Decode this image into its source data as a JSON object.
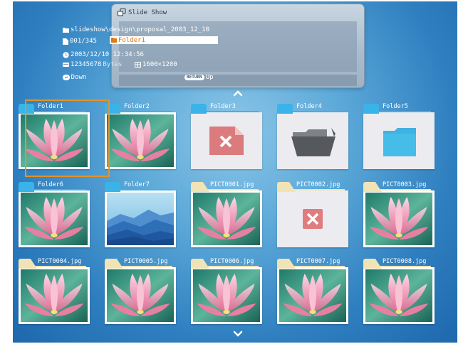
{
  "panel": {
    "title": "Slide Show",
    "path": "slideshow\\design\\proposal_2003_12_10",
    "count": "001/345",
    "folder_name": "Folder1",
    "date": "2003/12/10 12:34:56",
    "bytes_value": "12345678",
    "bytes_unit": "Bytes",
    "resolution": "1600×1200",
    "down_label": "Down",
    "up_button": "RETURN",
    "up_label": "Up"
  },
  "grid": {
    "items": [
      {
        "label": "Folder1",
        "kind": "folder",
        "thumb": "flower",
        "selected": true
      },
      {
        "label": "Folder2",
        "kind": "folder",
        "thumb": "flower"
      },
      {
        "label": "Folder3",
        "kind": "folder",
        "thumb": "broken-file"
      },
      {
        "label": "Folder4",
        "kind": "folder",
        "thumb": "open-folder"
      },
      {
        "label": "Folder5",
        "kind": "folder",
        "thumb": "blue-folder"
      },
      {
        "label": "Folder6",
        "kind": "folder",
        "thumb": "flower"
      },
      {
        "label": "Folder7",
        "kind": "folder",
        "thumb": "mountains"
      },
      {
        "label": "PICT0001.jpg",
        "kind": "file",
        "thumb": "flower"
      },
      {
        "label": "PICT0002.jpg",
        "kind": "file",
        "thumb": "error"
      },
      {
        "label": "PICT0003.jpg",
        "kind": "file",
        "thumb": "flower"
      },
      {
        "label": "PICT0004.jpg",
        "kind": "file",
        "thumb": "flower"
      },
      {
        "label": "PICT0005.jpg",
        "kind": "file",
        "thumb": "flower"
      },
      {
        "label": "PICT0006.jpg",
        "kind": "file",
        "thumb": "flower"
      },
      {
        "label": "PICT0007.jpg",
        "kind": "file",
        "thumb": "flower"
      },
      {
        "label": "PICT0008.jpg",
        "kind": "file",
        "thumb": "flower"
      }
    ]
  },
  "nav": {
    "up_icon": "chevron-up-icon",
    "down_icon": "chevron-down-icon"
  },
  "colors": {
    "selection": "#e3922b",
    "folder_tab": "#39b3e8",
    "file_tab": "#f0e3b6"
  }
}
